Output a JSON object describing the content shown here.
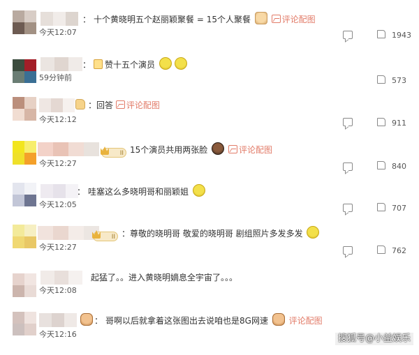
{
  "comments": [
    {
      "name_suffix": "：",
      "text": "十个黄晓明五个赵丽颖聚餐 = 15个人聚餐",
      "trail": "cat-emoji",
      "picture_link": "评论配图",
      "time": "今天12:07",
      "likes": "1943",
      "show_reply_icon": true
    },
    {
      "name_suffix": "：",
      "text": "赞十五个演员",
      "lead": "thumbs-up",
      "trail": "face-emoji-x2",
      "time": "59分钟前",
      "likes": "573",
      "show_reply_icon": false
    },
    {
      "name_suffix": "",
      "lead": "hand",
      "text": "：回答",
      "picture_link": "评论配图",
      "time": "今天12:12",
      "likes": "911",
      "show_reply_icon": true
    },
    {
      "name_suffix": "",
      "badge": "II",
      "text": "15个演员共用两张脸",
      "trail": "dark-emoji",
      "picture_link": "评论配图",
      "time": "今天12:27",
      "likes": "840",
      "show_reply_icon": true
    },
    {
      "name_suffix": "：",
      "text": "哇塞这么多晓明哥和丽颖姐",
      "trail": "face-emoji",
      "time": "今天12:05",
      "likes": "707",
      "show_reply_icon": true
    },
    {
      "name_suffix": "",
      "badge": "II",
      "text": "：尊敬的晓明哥 敬爱的晓明哥 剧组照片多发多发",
      "trail": "face-emoji",
      "time": "今天12:27",
      "likes": "762",
      "show_reply_icon": true
    },
    {
      "name_suffix": "",
      "text": "起猛了。。进入黄晓明嫡息全宇宙了。。。",
      "time": "今天12:08",
      "likes": "",
      "show_reply_icon": false
    },
    {
      "name_suffix": "：",
      "lead": "bunny",
      "text": "哥啊以后就拿着这张图出去说咱也是8G网速",
      "trail": "bunny-emoji",
      "picture_link": "评论配图",
      "time": "今天12:16",
      "likes": "",
      "show_reply_icon": false
    }
  ],
  "watermark": "搜狐号@小益娱乐",
  "colors": {
    "link": "#e27b68",
    "text": "#333333",
    "meta": "#555555"
  }
}
